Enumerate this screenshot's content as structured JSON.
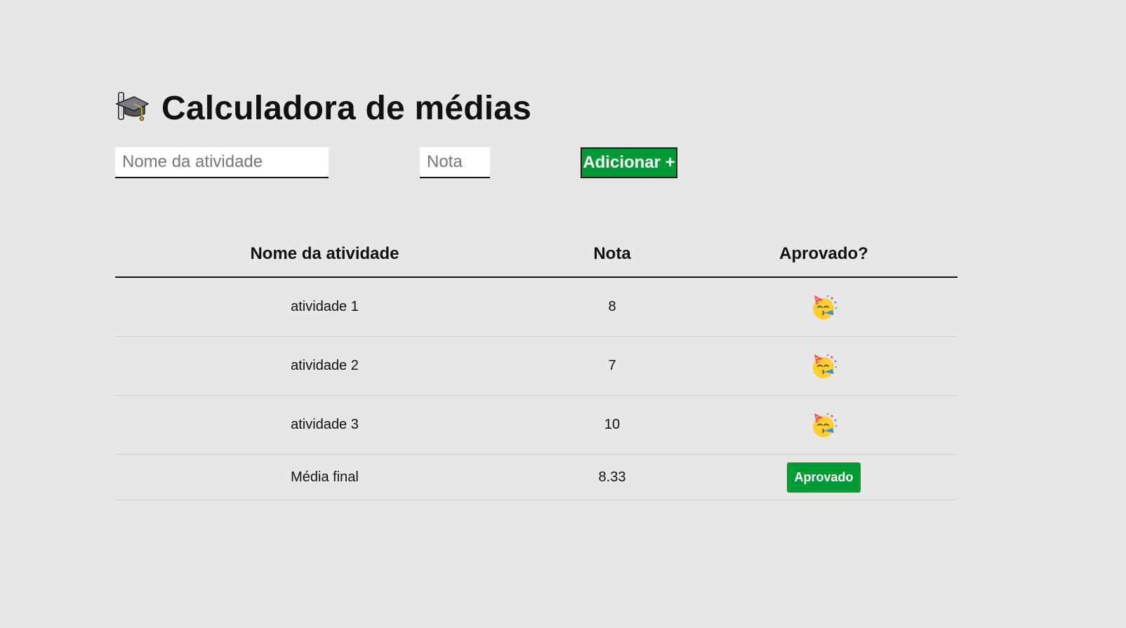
{
  "header": {
    "title": "Calculadora de médias",
    "icon": "graduation-cap-icon"
  },
  "form": {
    "activity_placeholder": "Nome da atividade",
    "activity_value": "",
    "grade_placeholder": "Nota",
    "grade_value": "",
    "add_label": "Adicionar +"
  },
  "table": {
    "headers": [
      "Nome da atividade",
      "Nota",
      "Aprovado?"
    ],
    "rows": [
      {
        "name": "atividade 1",
        "grade": "8",
        "status_icon": "party-face-icon"
      },
      {
        "name": "atividade 2",
        "grade": "7",
        "status_icon": "party-face-icon"
      },
      {
        "name": "atividade 3",
        "grade": "10",
        "status_icon": "party-face-icon"
      }
    ],
    "final": {
      "label": "Média final",
      "value": "8.33",
      "status": "Aprovado"
    }
  },
  "colors": {
    "background": "#e7e7e7",
    "accent_green": "#009b37",
    "text": "#111111"
  }
}
